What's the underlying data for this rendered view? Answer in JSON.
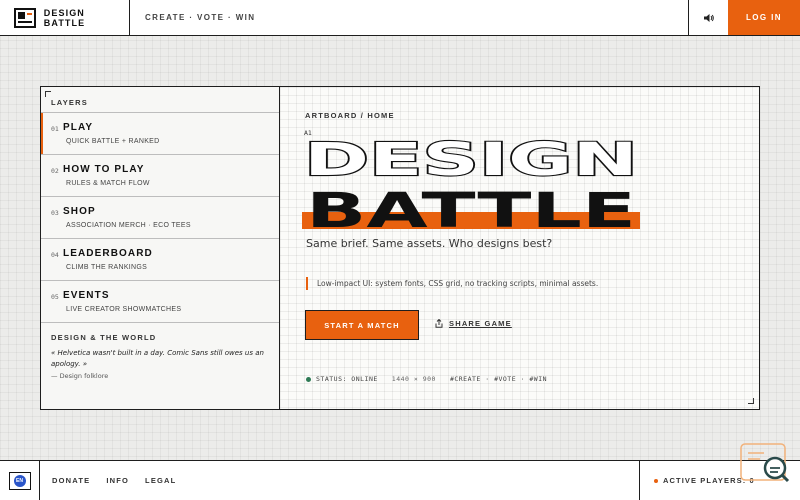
{
  "header": {
    "brand": "DESIGN BATTLE",
    "tagline": "CREATE · VOTE · WIN",
    "sound_icon": "speaker-icon",
    "login_label": "LOG IN"
  },
  "sidebar": {
    "title": "LAYERS",
    "items": [
      {
        "num": "01",
        "label": "PLAY",
        "sub": "QUICK BATTLE + RANKED"
      },
      {
        "num": "02",
        "label": "HOW TO PLAY",
        "sub": "RULES & MATCH FLOW"
      },
      {
        "num": "03",
        "label": "SHOP",
        "sub": "ASSOCIATION MERCH · ECO TEES"
      },
      {
        "num": "04",
        "label": "LEADERBOARD",
        "sub": "CLIMB THE RANKINGS"
      },
      {
        "num": "05",
        "label": "EVENTS",
        "sub": "LIVE CREATOR SHOWMATCHES"
      }
    ],
    "world": {
      "title": "DESIGN & THE WORLD",
      "quote": "« Helvetica wasn't built in a day. Comic Sans still owes us an apology. »",
      "attribution": "— Design folklore"
    }
  },
  "artboard": {
    "breadcrumb": "ARTBOARD / HOME",
    "artboard_id": "A1",
    "headline_line1": "DESIGN",
    "headline_line2": "BATTLE",
    "subtitle": "Same brief. Same assets. Who designs best?",
    "note": "Low-impact UI: system fonts, CSS grid, no tracking scripts, minimal assets.",
    "cta_label": "START A MATCH",
    "share_label": "SHARE GAME",
    "status_label": "STATUS: ONLINE",
    "resolution": "1440 × 900",
    "tags": "#CREATE · #VOTE · #WIN"
  },
  "footer": {
    "badge_text": "EN",
    "links": [
      "DONATE",
      "INFO",
      "LEGAL"
    ],
    "players_label": "ACTIVE PLAYERS: 0",
    "colors": {
      "accent": "#e8610f",
      "status": "#2e7a55",
      "badge": "#2a55c9"
    }
  }
}
